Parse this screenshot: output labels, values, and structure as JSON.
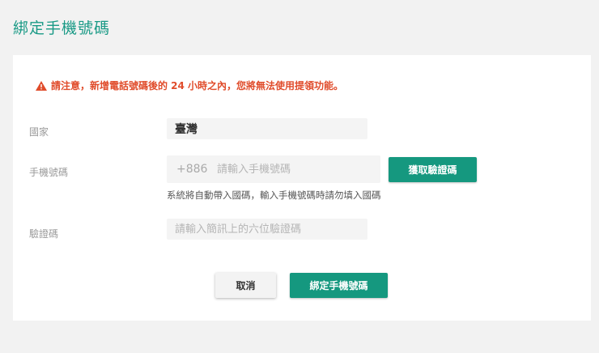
{
  "page": {
    "title": "綁定手機號碼"
  },
  "warning": {
    "icon": "warning-triangle-icon",
    "text": "請注意，新增電話號碼後的 24 小時之內，您將無法使用提領功能。",
    "color": "#e04c2b"
  },
  "form": {
    "country": {
      "label": "國家",
      "value": "臺灣"
    },
    "phone": {
      "label": "手機號碼",
      "prefix": "+886",
      "value": "",
      "placeholder": "請輸入手機號碼",
      "get_code_label": "獲取驗證碼",
      "hint": "系統將自動帶入國碼，輸入手機號碼時請勿填入國碼"
    },
    "code": {
      "label": "驗證碼",
      "value": "",
      "placeholder": "請輸入簡訊上的六位驗證碼"
    }
  },
  "actions": {
    "cancel_label": "取消",
    "submit_label": "綁定手機號碼"
  },
  "colors": {
    "brand": "#15987f",
    "title": "#1a9a86",
    "background": "#f2f2f2"
  }
}
